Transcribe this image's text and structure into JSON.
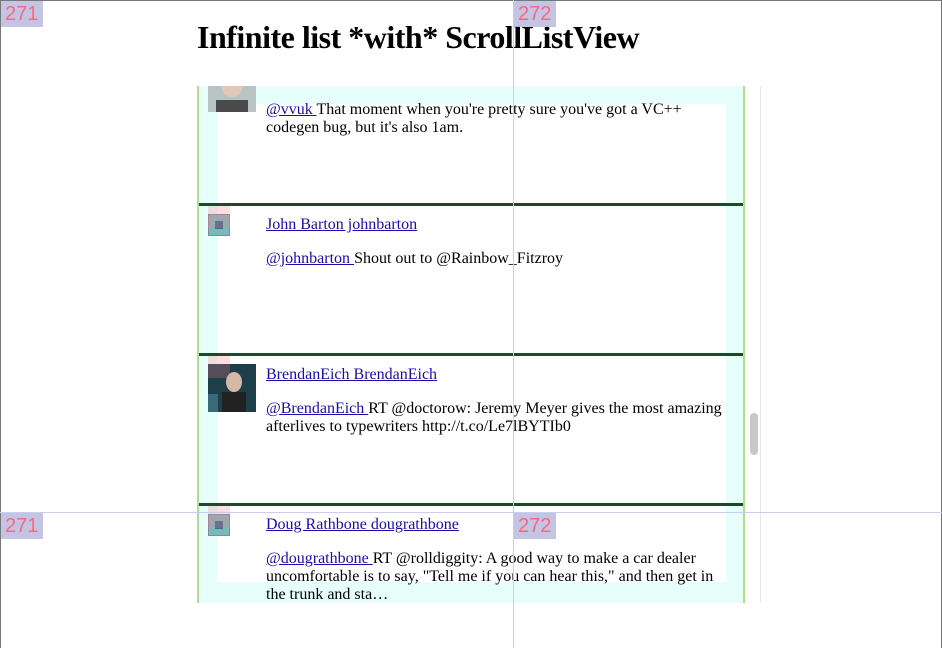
{
  "page": {
    "title": "Infinite list *with* ScrollListView"
  },
  "tiles": {
    "left_label": "271",
    "right_label": "272"
  },
  "tweets": [
    {
      "name": "",
      "mention": "@vvuk",
      "text": "That moment when you're pretty sure you've got a VC++ codegen bug, but it's also 1am."
    },
    {
      "name": "John Barton johnbarton",
      "mention": "@johnbarton",
      "text": "Shout out to @Rainbow_Fitzroy"
    },
    {
      "name": "BrendanEich BrendanEich",
      "mention": "@BrendanEich",
      "text": "RT @doctorow: Jeremy Meyer gives the most amazing afterlives to typewriters http://t.co/Le7lBYTIb0"
    },
    {
      "name": "Doug Rathbone dougrathbone",
      "mention": "@dougrathbone",
      "text": "RT @rolldiggity: A good way to make a car dealer uncomfortable is to say, \"Tell me if you can hear this,\" and then get in the trunk and sta…"
    }
  ]
}
